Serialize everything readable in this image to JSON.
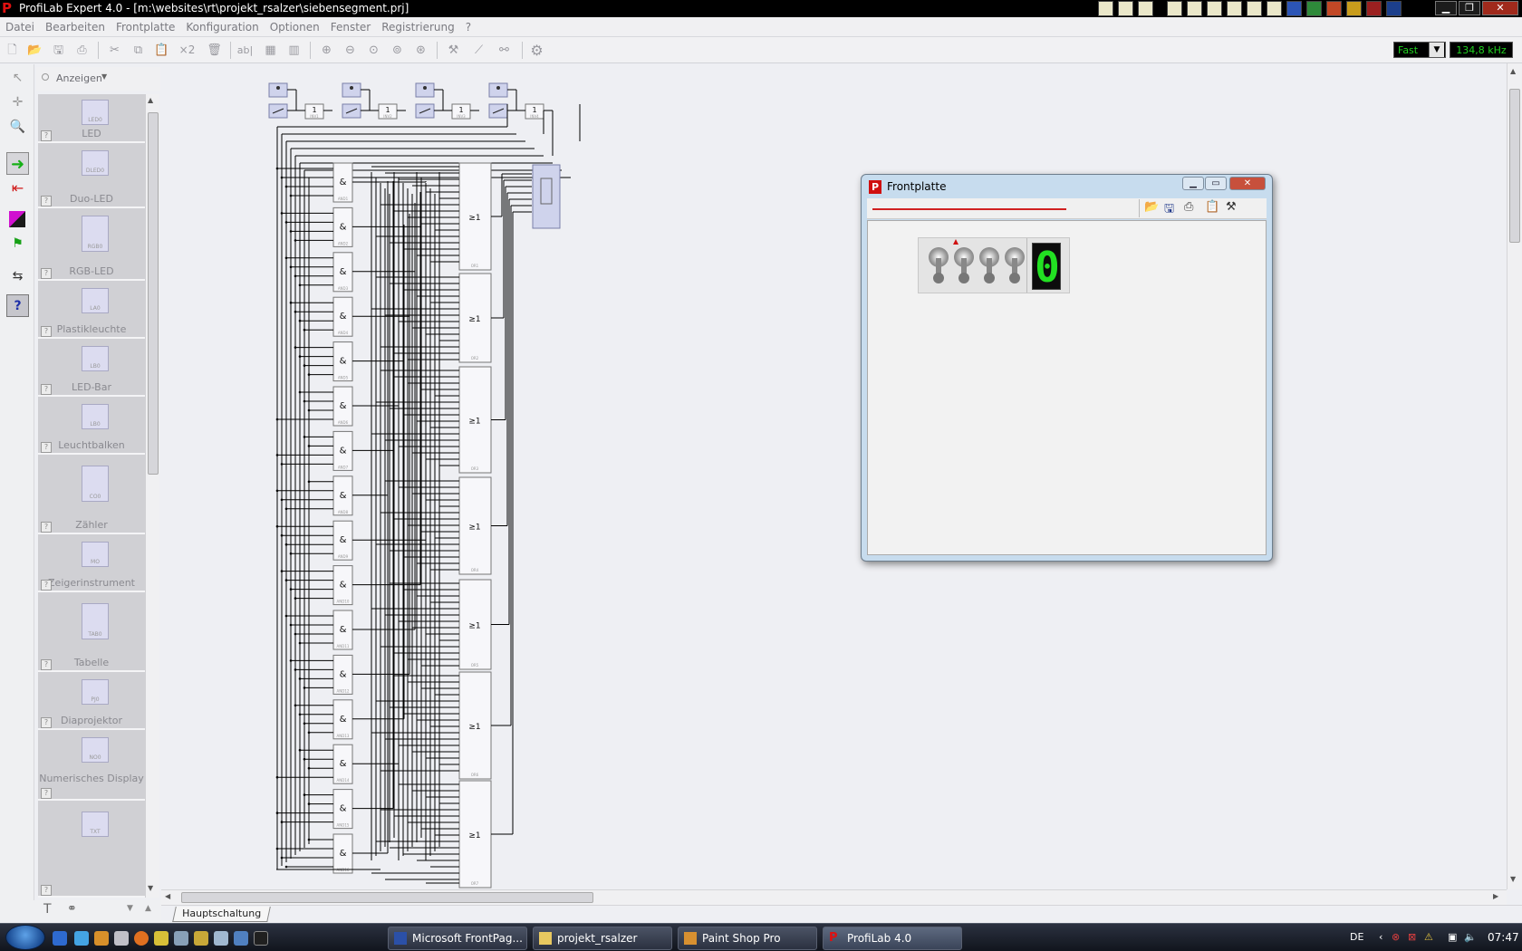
{
  "window": {
    "title": "ProfiLab Expert 4.0 - [m:\\websites\\rt\\projekt_rsalzer\\siebensegment.prj]",
    "logo": "P"
  },
  "menu": [
    "Datei",
    "Bearbeiten",
    "Frontplatte",
    "Konfiguration",
    "Optionen",
    "Fenster",
    "Registrierung",
    "?"
  ],
  "toolbar": {
    "multiply_label": "×2",
    "text_label": "ab|",
    "speed": "Fast",
    "frequency": "134,8 kHz"
  },
  "palette": {
    "header": "Anzeigen",
    "items": [
      {
        "label": "LED",
        "tag": "LED0"
      },
      {
        "label": "Duo-LED",
        "tag": "DLED0"
      },
      {
        "label": "RGB-LED",
        "tag": "RGB0"
      },
      {
        "label": "Plastikleuchte",
        "tag": "LA0"
      },
      {
        "label": "LED-Bar",
        "tag": "LB0"
      },
      {
        "label": "Leuchtbalken",
        "tag": "LB0"
      },
      {
        "label": "Zähler",
        "tag": "CO0"
      },
      {
        "label": "Zeigerinstrument",
        "tag": "MO"
      },
      {
        "label": "Tabelle",
        "tag": "TAB0"
      },
      {
        "label": "Diaprojektor",
        "tag": "PJ0"
      },
      {
        "label": "Numerisches Display",
        "tag": "NO0"
      },
      {
        "label": "",
        "tag": "TXT"
      }
    ]
  },
  "circuit": {
    "and_symbol": "&",
    "or_symbol": "≥1",
    "inv_symbol": "1",
    "and_gates": [
      "AND1",
      "AND2",
      "AND3",
      "AND4",
      "AND5",
      "AND6",
      "AND7",
      "AND8",
      "AND9",
      "AND10",
      "AND11",
      "AND12",
      "AND13",
      "AND14",
      "AND15",
      "AND16"
    ],
    "or_gates": [
      "OR1",
      "OR2",
      "OR3",
      "OR4",
      "OR5",
      "OR6",
      "OR7"
    ],
    "inverters": [
      "INV1",
      "INV2",
      "INV3",
      "INV4"
    ]
  },
  "sheet_tab": "Hauptschaltung",
  "frontplate": {
    "title": "Frontplatte",
    "display_digit": "0"
  },
  "taskbar": {
    "tasks": [
      "Microsoft FrontPag...",
      "projekt_rsalzer",
      "Paint Shop Pro",
      "ProfiLab 4.0"
    ],
    "language": "DE",
    "clock": "07:47"
  },
  "colors": {
    "accent": "#e01010",
    "lcd_green": "#20d020",
    "gate_fill": "#f7f7fa",
    "wire": "#000000"
  }
}
